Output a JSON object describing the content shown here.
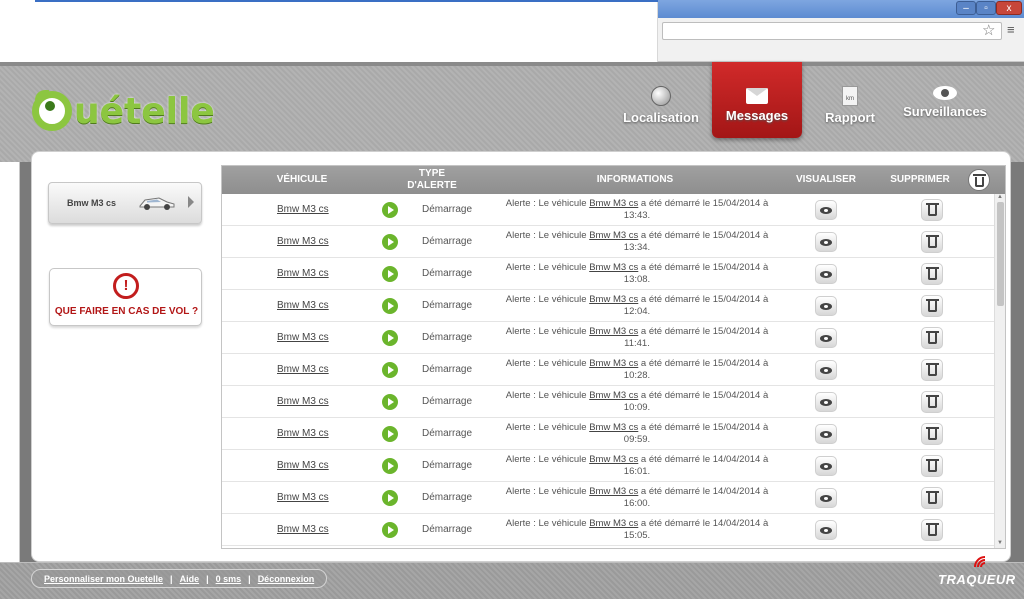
{
  "window": {
    "buttons": {
      "minimize": "–",
      "maximize": "▫",
      "close": "x"
    }
  },
  "brand": {
    "logo_text": "uételle",
    "colors": {
      "logo_green": "#8cc640",
      "active_red": "#c21d1d",
      "play_green": "#6bb52c"
    }
  },
  "nav": {
    "items": [
      {
        "label": "Localisation",
        "icon": "globe-icon"
      },
      {
        "label": "Messages",
        "icon": "envelope-icon",
        "active": true
      },
      {
        "label": "Rapport",
        "icon": "km-icon",
        "icon_text": "km"
      },
      {
        "label": "Surveillances",
        "icon": "eye-icon"
      }
    ]
  },
  "sidebar": {
    "vehicle_card": {
      "label": "Bmw M3 cs",
      "icon": "car-icon"
    },
    "theft": {
      "label": "QUE FAIRE EN CAS DE VOL ?",
      "icon_text": "!"
    }
  },
  "table": {
    "headers": {
      "vehicule": "VÉHICULE",
      "type_line1": "TYPE",
      "type_line2": "D'ALERTE",
      "informations": "INFORMATIONS",
      "visualiser": "VISUALISER",
      "supprimer": "SUPPRIMER"
    },
    "rows": [
      {
        "vehicle": "Bmw M3 cs",
        "type": "Démarrage",
        "info_prefix": "Alerte : Le véhicule ",
        "info_vehicle": "Bmw M3 cs",
        "info_suffix": " a été démarré le 15/04/2014 à",
        "time": "13:43."
      },
      {
        "vehicle": "Bmw M3 cs",
        "type": "Démarrage",
        "info_prefix": "Alerte : Le véhicule ",
        "info_vehicle": "Bmw M3 cs",
        "info_suffix": " a été démarré le 15/04/2014 à",
        "time": "13:34."
      },
      {
        "vehicle": "Bmw M3 cs",
        "type": "Démarrage",
        "info_prefix": "Alerte : Le véhicule ",
        "info_vehicle": "Bmw M3 cs",
        "info_suffix": " a été démarré le 15/04/2014 à",
        "time": "13:08."
      },
      {
        "vehicle": "Bmw M3 cs",
        "type": "Démarrage",
        "info_prefix": "Alerte : Le véhicule ",
        "info_vehicle": "Bmw M3 cs",
        "info_suffix": " a été démarré le 15/04/2014 à",
        "time": "12:04."
      },
      {
        "vehicle": "Bmw M3 cs",
        "type": "Démarrage",
        "info_prefix": "Alerte : Le véhicule ",
        "info_vehicle": "Bmw M3 cs",
        "info_suffix": " a été démarré le 15/04/2014 à",
        "time": "11:41."
      },
      {
        "vehicle": "Bmw M3 cs",
        "type": "Démarrage",
        "info_prefix": "Alerte : Le véhicule ",
        "info_vehicle": "Bmw M3 cs",
        "info_suffix": " a été démarré le 15/04/2014 à",
        "time": "10:28."
      },
      {
        "vehicle": "Bmw M3 cs",
        "type": "Démarrage",
        "info_prefix": "Alerte : Le véhicule ",
        "info_vehicle": "Bmw M3 cs",
        "info_suffix": " a été démarré le 15/04/2014 à",
        "time": "10:09."
      },
      {
        "vehicle": "Bmw M3 cs",
        "type": "Démarrage",
        "info_prefix": "Alerte : Le véhicule ",
        "info_vehicle": "Bmw M3 cs",
        "info_suffix": " a été démarré le 15/04/2014 à",
        "time": "09:59."
      },
      {
        "vehicle": "Bmw M3 cs",
        "type": "Démarrage",
        "info_prefix": "Alerte : Le véhicule ",
        "info_vehicle": "Bmw M3 cs",
        "info_suffix": " a été démarré le 14/04/2014 à",
        "time": "16:01."
      },
      {
        "vehicle": "Bmw M3 cs",
        "type": "Démarrage",
        "info_prefix": "Alerte : Le véhicule ",
        "info_vehicle": "Bmw M3 cs",
        "info_suffix": " a été démarré le 14/04/2014 à",
        "time": "16:00."
      },
      {
        "vehicle": "Bmw M3 cs",
        "type": "Démarrage",
        "info_prefix": "Alerte : Le véhicule ",
        "info_vehicle": "Bmw M3 cs",
        "info_suffix": " a été démarré le 14/04/2014 à",
        "time": "15:05."
      }
    ]
  },
  "footer": {
    "links": [
      "Personnaliser mon Ouetelle",
      "Aide",
      "0 sms",
      "Déconnexion"
    ],
    "separator": "|",
    "brand": "TRAQUEUR"
  }
}
